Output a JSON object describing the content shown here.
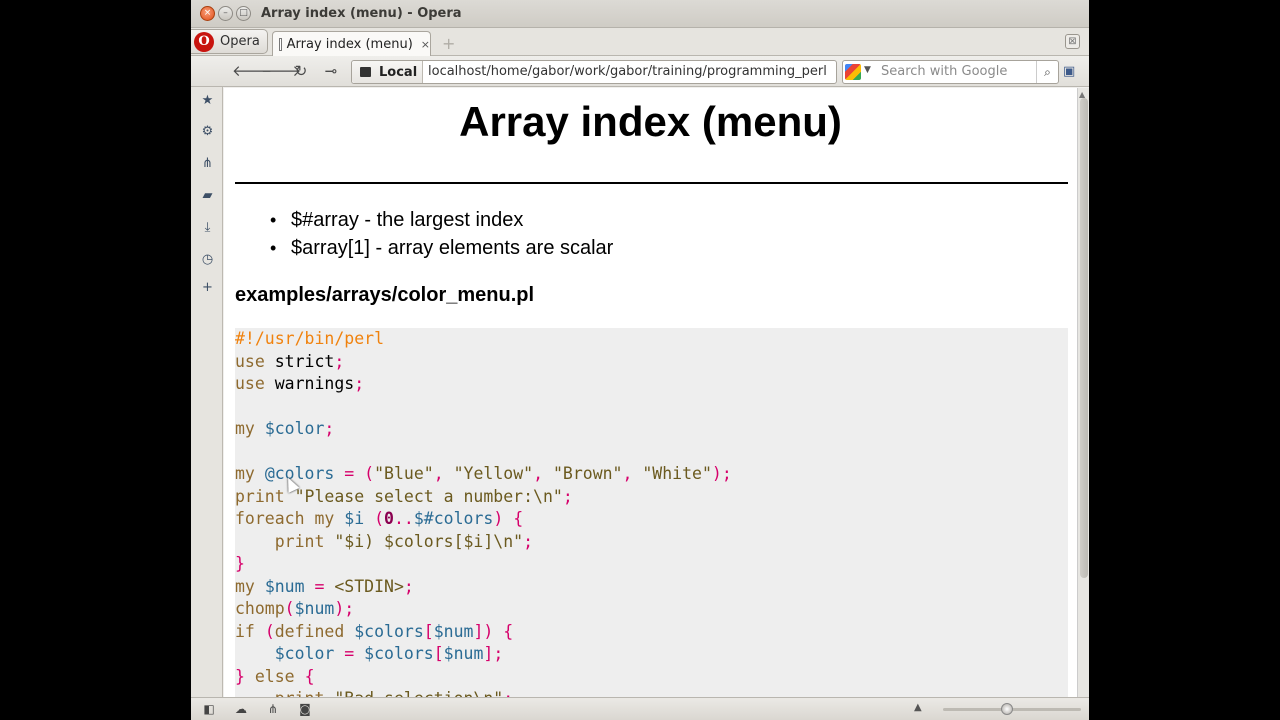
{
  "window": {
    "title": "Array index (menu) - Opera"
  },
  "tabbar": {
    "opera_label": "Opera",
    "opera_logo": "O",
    "tab_label": "Array index (menu)",
    "tab_close": "×",
    "new_tab": "+",
    "closed_tabs": "⊠"
  },
  "toolbar": {
    "back": "🡐",
    "forward": "🡒",
    "reload": "↻",
    "key": "⊸",
    "site_label": "Local",
    "url": "localhost/home/gabor/work/gabor/training/programming_perl",
    "search_placeholder": "Search with Google",
    "search_btn": "⌕"
  },
  "sidepanel": {
    "icons": [
      "bookmarks-icon",
      "settings-icon",
      "unite-icon",
      "notes-icon",
      "downloads-icon",
      "history-icon",
      "add-panel-icon"
    ]
  },
  "page": {
    "heading": "Array index (menu)",
    "bullets": [
      "$#array - the largest index",
      "$array[1] - array elements are scalar"
    ],
    "file_heading": "examples/arrays/color_menu.pl"
  },
  "code_lines": [
    "#!/usr/bin/perl",
    "use strict;",
    "use warnings;",
    "",
    "my $color;",
    "",
    "my @colors = (\"Blue\", \"Yellow\", \"Brown\", \"White\");",
    "print \"Please select a number:\\n\";",
    "foreach my $i (0..$#colors) {",
    "    print \"$i) $colors[$i]\\n\";",
    "}",
    "my $num = <STDIN>;",
    "chomp($num);",
    "if (defined $colors[$num]) {",
    "    $color = $colors[$num];",
    "} else {",
    "    print \"Bad selection\\n\";"
  ],
  "colors": {
    "shebang": "#f0820e",
    "keyword": "#8e6a2f",
    "variable": "#2a6b94",
    "operator": "#d6006b",
    "string": "#6b5a1f",
    "code_bg": "#eeeeee"
  }
}
